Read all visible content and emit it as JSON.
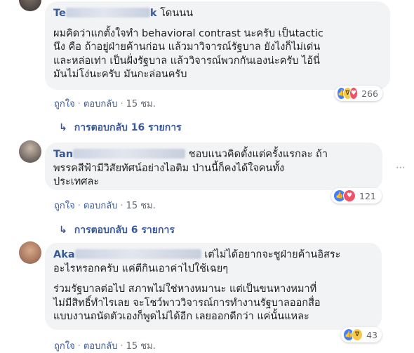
{
  "comments": [
    {
      "author_visible": "Te",
      "author_suffix": "k",
      "body_lines": [
        " โดนนน",
        "ผมคิดว่าแกตั้งใจทำ behavioral contrast นะครับ เป็นtactic",
        "นึง คือ ถ้าอยู่ฝ่ายค้านก่อน แล้วมาวิจารณ์รัฐบาล ยังไงก็ไม่เด่น",
        "และหล่อเท่า เป็นฝั่งรัฐบาล แล้ววิจารณ์พวกกันเองน่ะครับ ไอ้นี่",
        "มันไม่โง่นะครับ มันกะล่อนครับ"
      ],
      "reaction_count": "266",
      "like_label": "ถูกใจ",
      "reply_label": "ตอบกลับ",
      "time": "15 ชม.",
      "replies_label": "การตอบกลับ 16 รายการ"
    },
    {
      "author_visible": "Tan",
      "body_lines": [
        " ชอบแนวคิดตั้งแต่ครั้งแรกละ ถ้า",
        "พรรคสีฟ้ามีวิสัยทัศน์อย่างไอติม ป่านนี้ก็คงได้ใจคนทั้ง",
        "ประเทศละ"
      ],
      "reaction_count": "121",
      "like_label": "ถูกใจ",
      "reply_label": "ตอบกลับ",
      "time": "15 ชม.",
      "replies_label": "การตอบกลับ 6 รายการ"
    },
    {
      "author_visible": "Aka",
      "body_lines": [
        " เต่ไม่ได้อยากจะชูฝ่ายค้านอิสระ",
        "อะไรหรอกครับ แค่ตีกินเอาค่าไปใช้เฉยๆ"
      ],
      "body_lines_2": [
        "ร่วมรัฐบาลต่อไป สภาพไม่ใช่หางหมานะ แต่เป็นขนหางหมาที่",
        "ไม่มีสิทธิ์ทำไรเลย จะโชว์พาววิจารณ์การทำงานรัฐบาลออกสื่อ",
        "แบบงานถนัดตัวเองก็พูดไม่ได้อีก เลยออกดีกว่า แค่นั้นแหละ"
      ],
      "reaction_count": "43",
      "like_label": "ถูกใจ",
      "reply_label": "ตอบกลับ",
      "time": "15 ชม."
    }
  ],
  "more_icon": "more-horizontal-icon",
  "colors": {
    "bubble": "#f2f3f5",
    "author": "#385898",
    "link": "#385898",
    "muted": "#606770",
    "like": "#4080ff",
    "love": "#f25268",
    "haha": "#f7c94a"
  }
}
